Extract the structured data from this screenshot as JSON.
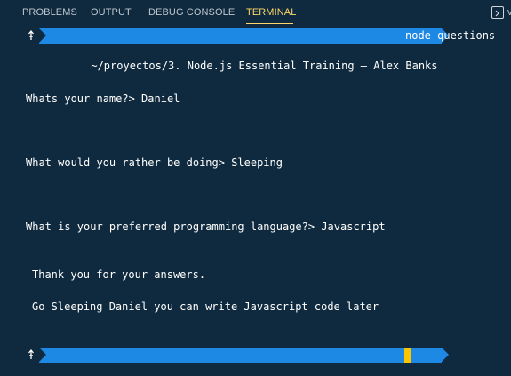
{
  "tabs": {
    "problems": "PROBLEMS",
    "output": "OUTPUT",
    "debug_console": "DEBUG CONSOLE",
    "terminal": "TERMINAL"
  },
  "edge_text": "v",
  "prompt": {
    "path": "~/proyectos/3. Node.js Essential Training – Alex Banks",
    "command": "node questions"
  },
  "output_lines": {
    "q1": "Whats your name?> Daniel",
    "q2": "What would you rather be doing> Sleeping",
    "q3": "What is your preferred programming language?> Javascript",
    "thanks": "Thank you for your answers.",
    "summary": "Go Sleeping Daniel you can write Javascript code later"
  },
  "colors": {
    "background": "#0f2a3e",
    "segment": "#1e88e5",
    "active_tab": "#ffd86b",
    "cursor": "#ffc400"
  }
}
